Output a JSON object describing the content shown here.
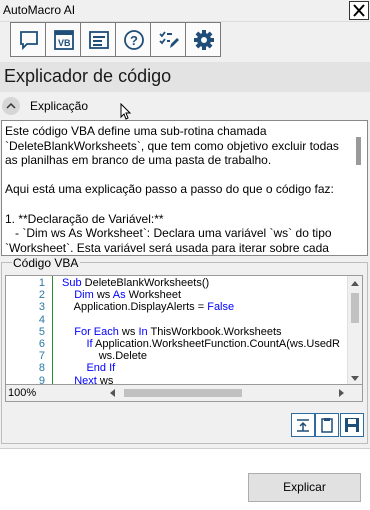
{
  "window": {
    "title": "AutoMacro AI"
  },
  "toolbar": {
    "buttons": [
      {
        "icon": "chat-icon"
      },
      {
        "icon": "vb-icon"
      },
      {
        "icon": "document-icon"
      },
      {
        "icon": "help-icon"
      },
      {
        "icon": "edit-checklist-icon"
      },
      {
        "icon": "gear-icon"
      }
    ]
  },
  "page": {
    "title": "Explicador de código"
  },
  "explanation": {
    "section_label": "Explicação",
    "text": "Este código VBA define uma sub-rotina chamada `DeleteBlankWorksheets`, que tem como objetivo excluir todas as planilhas em branco de uma pasta de trabalho.\n\nAqui está uma explicação passo a passo do que o código faz:\n\n1. **Declaração de Variável:**\n   - `Dim ws As Worksheet`: Declara uma variável `ws` do tipo `Worksheet`. Esta variável será usada para iterar sobre cada"
  },
  "code_section": {
    "label": "Código VBA",
    "zoom": "100%",
    "lines": [
      {
        "num": "1",
        "indent": "",
        "parts": [
          {
            "t": "Sub",
            "kw": true
          },
          {
            "t": " DeleteBlankWorksheets()"
          }
        ]
      },
      {
        "num": "2",
        "indent": "    ",
        "parts": [
          {
            "t": "Dim",
            "kw": true
          },
          {
            "t": " ws "
          },
          {
            "t": "As",
            "kw": true
          },
          {
            "t": " Worksheet"
          }
        ]
      },
      {
        "num": "3",
        "indent": "    ",
        "parts": [
          {
            "t": "Application.DisplayAlerts = "
          },
          {
            "t": "False",
            "kw": true
          }
        ]
      },
      {
        "num": "4",
        "indent": "",
        "parts": []
      },
      {
        "num": "5",
        "indent": "    ",
        "parts": [
          {
            "t": "For Each",
            "kw": true
          },
          {
            "t": " ws "
          },
          {
            "t": "In",
            "kw": true
          },
          {
            "t": " ThisWorkbook.Worksheets"
          }
        ]
      },
      {
        "num": "6",
        "indent": "        ",
        "parts": [
          {
            "t": "If",
            "kw": true
          },
          {
            "t": " Application.WorksheetFunction.CountA(ws.UsedR"
          }
        ]
      },
      {
        "num": "7",
        "indent": "            ",
        "parts": [
          {
            "t": "ws.Delete"
          }
        ]
      },
      {
        "num": "8",
        "indent": "        ",
        "parts": [
          {
            "t": "End If",
            "kw": true
          }
        ]
      },
      {
        "num": "9",
        "indent": "    ",
        "parts": [
          {
            "t": "Next",
            "kw": true
          },
          {
            "t": " ws"
          }
        ]
      }
    ]
  },
  "actions": {
    "buttons": [
      {
        "icon": "insert-code-icon"
      },
      {
        "icon": "clipboard-icon"
      },
      {
        "icon": "save-icon"
      }
    ]
  },
  "footer": {
    "explain_label": "Explicar"
  },
  "colors": {
    "keyword": "#0000ff",
    "line_number": "#2b7ba0",
    "header_band": "#e3e3e3"
  }
}
